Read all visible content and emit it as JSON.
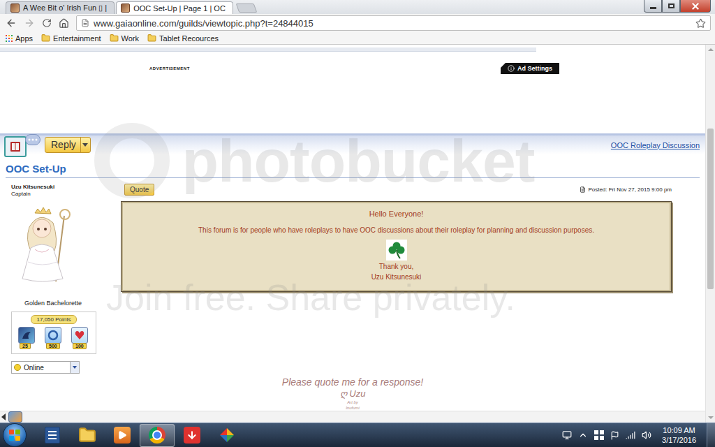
{
  "browser": {
    "tabs": [
      {
        "label": "A Wee Bit o' Irish Fun ▯ |",
        "selected": false
      },
      {
        "label": "OOC Set-Up | Page 1 | OC",
        "selected": true
      }
    ],
    "url": "www.gaiaonline.com/guilds/viewtopic.php?t=24844015",
    "bookmarks": [
      {
        "label": "Apps",
        "kind": "apps"
      },
      {
        "label": "Entertainment",
        "kind": "folder"
      },
      {
        "label": "Work",
        "kind": "folder"
      },
      {
        "label": "Tablet Recources",
        "kind": "folder"
      }
    ]
  },
  "page": {
    "ad": {
      "label": "ADVERTISEMENT",
      "settings": "Ad Settings"
    },
    "toolbar": {
      "reply": "Reply",
      "forum_link": "OOC Roleplay Discussion"
    },
    "topic_title": "OOC Set-Up",
    "post": {
      "author": "Uzu Kitsunesuki",
      "rank": "Captain",
      "title": "Golden Bachelorette",
      "points": "17,050 Points",
      "badges": [
        {
          "count": "25",
          "kind": "dragon"
        },
        {
          "count": "500",
          "kind": "ring"
        },
        {
          "count": "100",
          "kind": "heart"
        }
      ],
      "status": "Online",
      "quote_button": "Quote",
      "posted": "Posted: Fri Nov 27, 2015 9:00 pm",
      "message": {
        "greeting": "Hello Everyone!",
        "body": "This forum is for people who have roleplays to have OOC discussions about their roleplay for planning and discussion purposes.",
        "thanks": "Thank you,",
        "signoff": "Uzu Kitsunesuki"
      },
      "signature": {
        "line": "Please quote me for a response!",
        "name": "ღ Uzu",
        "credit_label": "Art by",
        "credit_name": "Inufumi"
      }
    },
    "scrollbar": {
      "level": 0.38
    }
  },
  "watermark": {
    "logo": "photobucket",
    "slogan": "Join free. Share privately."
  },
  "taskbar": {
    "apps": [
      {
        "kind": "word",
        "selected": false
      },
      {
        "kind": "explorer",
        "selected": false
      },
      {
        "kind": "media",
        "selected": false
      },
      {
        "kind": "chrome",
        "selected": true
      },
      {
        "kind": "download",
        "selected": false
      },
      {
        "kind": "avg",
        "selected": false
      }
    ],
    "time": "10:09 AM",
    "date": "3/17/2016"
  }
}
